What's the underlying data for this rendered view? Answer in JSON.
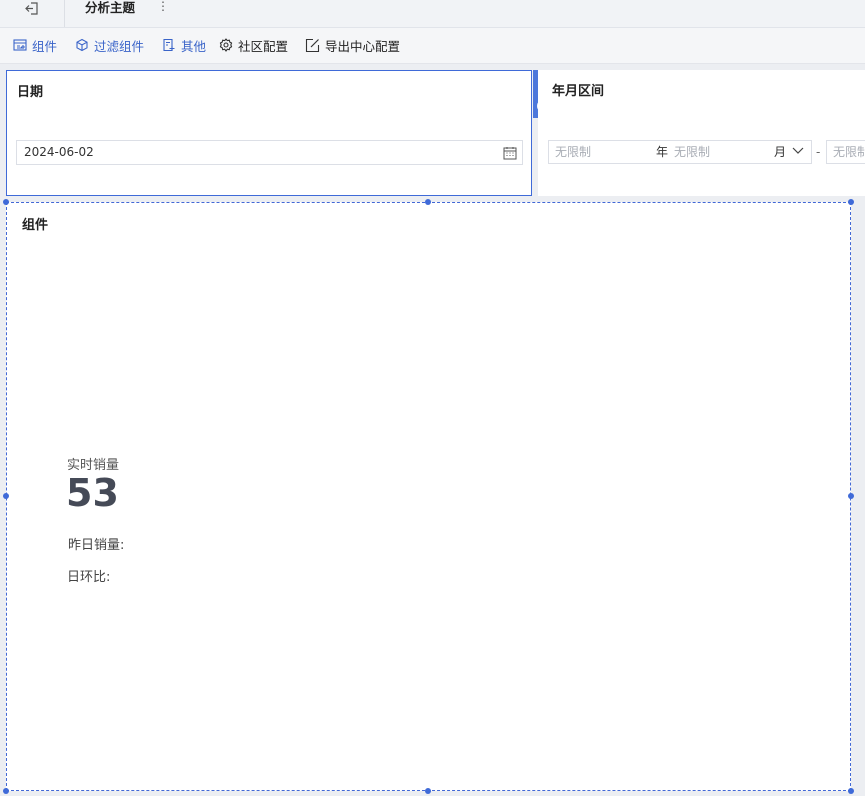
{
  "topbar": {
    "title": "分析主题",
    "more_glyph": "⋮",
    "exit_icon": "exit-icon"
  },
  "toolbar": {
    "items": [
      {
        "label": "组件",
        "icon": "component-icon"
      },
      {
        "label": "过滤组件",
        "icon": "filter-cube-icon"
      },
      {
        "label": "其他",
        "icon": "other-icon"
      },
      {
        "label": "社区配置",
        "icon": "gear-icon"
      },
      {
        "label": "导出中心配置",
        "icon": "export-edit-icon"
      }
    ],
    "accent_color": "#3a64c9"
  },
  "date_panel": {
    "title": "日期",
    "value": "2024-06-02",
    "icon": "calendar-icon"
  },
  "side_tools": {
    "edit_icon": "edit-icon",
    "collapse_icon": "chevron-circle-icon"
  },
  "range_panel": {
    "title": "年月区间",
    "start_year_placeholder": "无限制",
    "year_unit": "年",
    "start_month_placeholder": "无限制",
    "month_unit": "月",
    "separator": "-",
    "end_placeholder": "无限制"
  },
  "widget_panel": {
    "title": "组件",
    "kpi_label": "实时销量",
    "kpi_value": "53",
    "yesterday_label": "昨日销量:",
    "dod_label": "日环比:"
  },
  "colors": {
    "selection": "#3f6ad8",
    "kpi_value": "#454a57"
  }
}
